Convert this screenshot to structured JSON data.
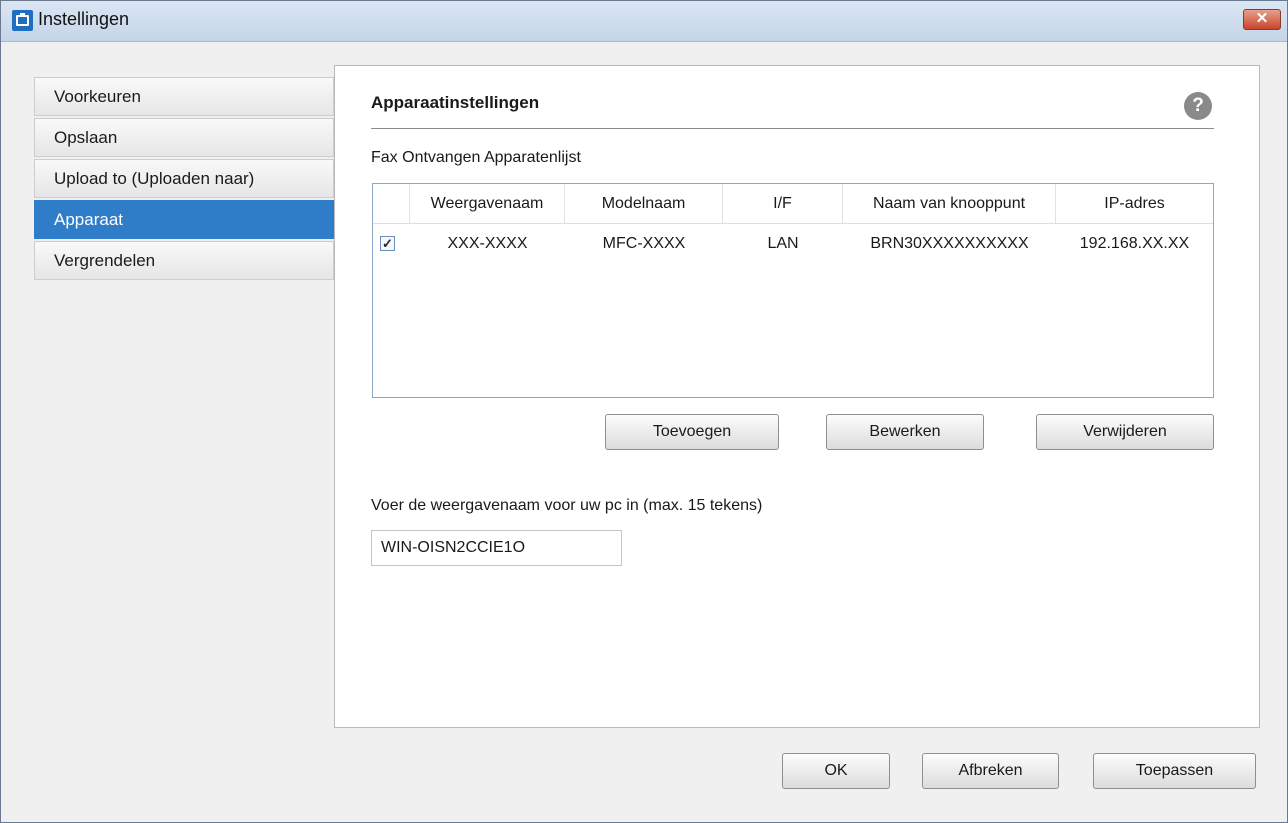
{
  "window": {
    "title": "Instellingen",
    "close_label": "✕"
  },
  "sidebar": {
    "items": [
      {
        "label": "Voorkeuren"
      },
      {
        "label": "Opslaan"
      },
      {
        "label": "Upload to (Uploaden naar)"
      },
      {
        "label": "Apparaat"
      },
      {
        "label": "Vergrendelen"
      }
    ],
    "active": "Apparaat"
  },
  "main": {
    "section_title": "Apparaatinstellingen",
    "help_icon": "?",
    "list_label": "Fax Ontvangen Apparatenlijst",
    "table": {
      "columns": [
        "Weergavenaam",
        "Modelnaam",
        "I/F",
        "Naam van knooppunt",
        "IP-adres"
      ],
      "rows": [
        {
          "checked": true,
          "check_mark": "✓",
          "cells": [
            "XXX-XXXX",
            "MFC-XXXX",
            "LAN",
            "BRN30XXXXXXXXXX",
            "192.168.XX.XX"
          ]
        }
      ]
    },
    "buttons": {
      "add": "Toevoegen",
      "edit": "Bewerken",
      "delete": "Verwijderen"
    },
    "pc_name_label": "Voer de weergavenaam voor uw pc in (max. 15 tekens)",
    "pc_name_value": "WIN-OISN2CCIE1O"
  },
  "footer": {
    "ok": "OK",
    "cancel": "Afbreken",
    "apply": "Toepassen"
  },
  "colors": {
    "accent": "#2f7dc8",
    "close": "#c9452d"
  }
}
